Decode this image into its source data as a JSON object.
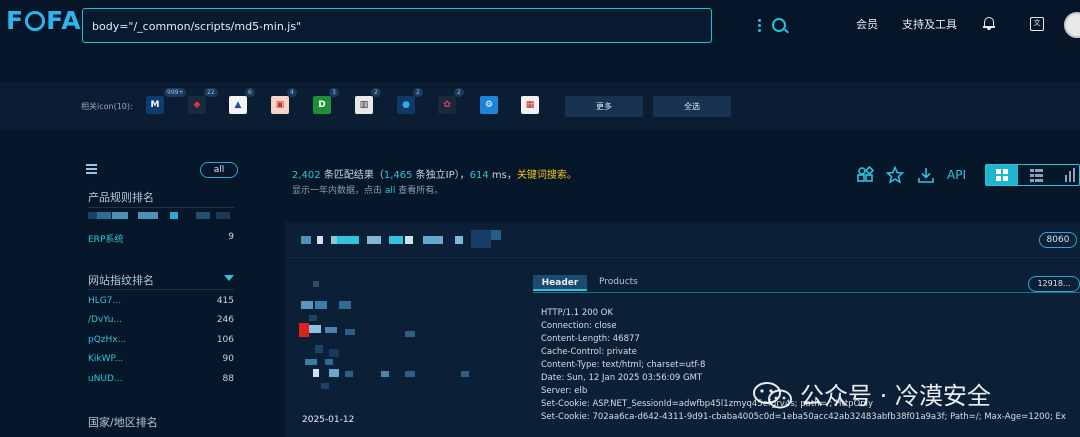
{
  "app": {
    "logo_text": "FOFA",
    "colors": {
      "accent": "#2fc4dc",
      "keyword": "#f3c623",
      "background": "#07172a"
    }
  },
  "search": {
    "value": "body=\"/_common/scripts/md5-min.js\"",
    "icon": "search-icon"
  },
  "nav": {
    "member": "会员",
    "support": "支持及工具"
  },
  "related_icons": {
    "label": "相关icon(10):",
    "badges": [
      "999+",
      "22",
      "6",
      "4",
      "3",
      "2",
      "2",
      "2"
    ],
    "more": "更多",
    "select_all": "全选"
  },
  "sidebar": {
    "all_label": "all",
    "product_title": "产品规则排名",
    "product_rows": [
      {
        "name": "ERP系统",
        "count": "9"
      }
    ],
    "fingerprint_title": "网站指纹排名",
    "fingerprint_rows": [
      {
        "name": "HLG7...",
        "count": "415"
      },
      {
        "name": "/DvYu...",
        "count": "246"
      },
      {
        "name": "pQzHx...",
        "count": "106"
      },
      {
        "name": "KikWP...",
        "count": "90"
      },
      {
        "name": "uNUD...",
        "count": "88"
      }
    ],
    "region_title": "国家/地区排名"
  },
  "results": {
    "total": "2,402",
    "total_text": " 条匹配结果（",
    "unique": "1,465",
    "unique_text": " 条独立IP），",
    "ms": "614",
    "ms_text": " ms，",
    "keyword_search": "关键词搜索。",
    "note_prefix": "显示一年内数据，点击 ",
    "note_link": "all",
    "note_suffix": " 查看所有。",
    "api_label": "API"
  },
  "card": {
    "port": "8060",
    "date": "2025-01-12",
    "tab_header": "Header",
    "tab_products": "Products",
    "count_pill": "12918...",
    "header_lines": [
      "HTTP/1.1 200 OK",
      "Connection: close",
      "Content-Length: 46877",
      "Cache-Control: private",
      "Content-Type: text/html; charset=utf-8",
      "Date: Sun, 12 Jan 2025 03:56:09 GMT",
      "Server: elb",
      "Set-Cookie: ASP.NET_SessionId=adwfbp45l1zmyq45efgrv4s; path=/; HttpOnly",
      "Set-Cookie: 702aa6ca-d642-4311-9d91-cbaba4005c0d=1eba50acc42ab32483abfb38f01a9a3f; Path=/; Max-Age=1200; Ex"
    ]
  },
  "watermark": "公众号 · 冷漠安全"
}
